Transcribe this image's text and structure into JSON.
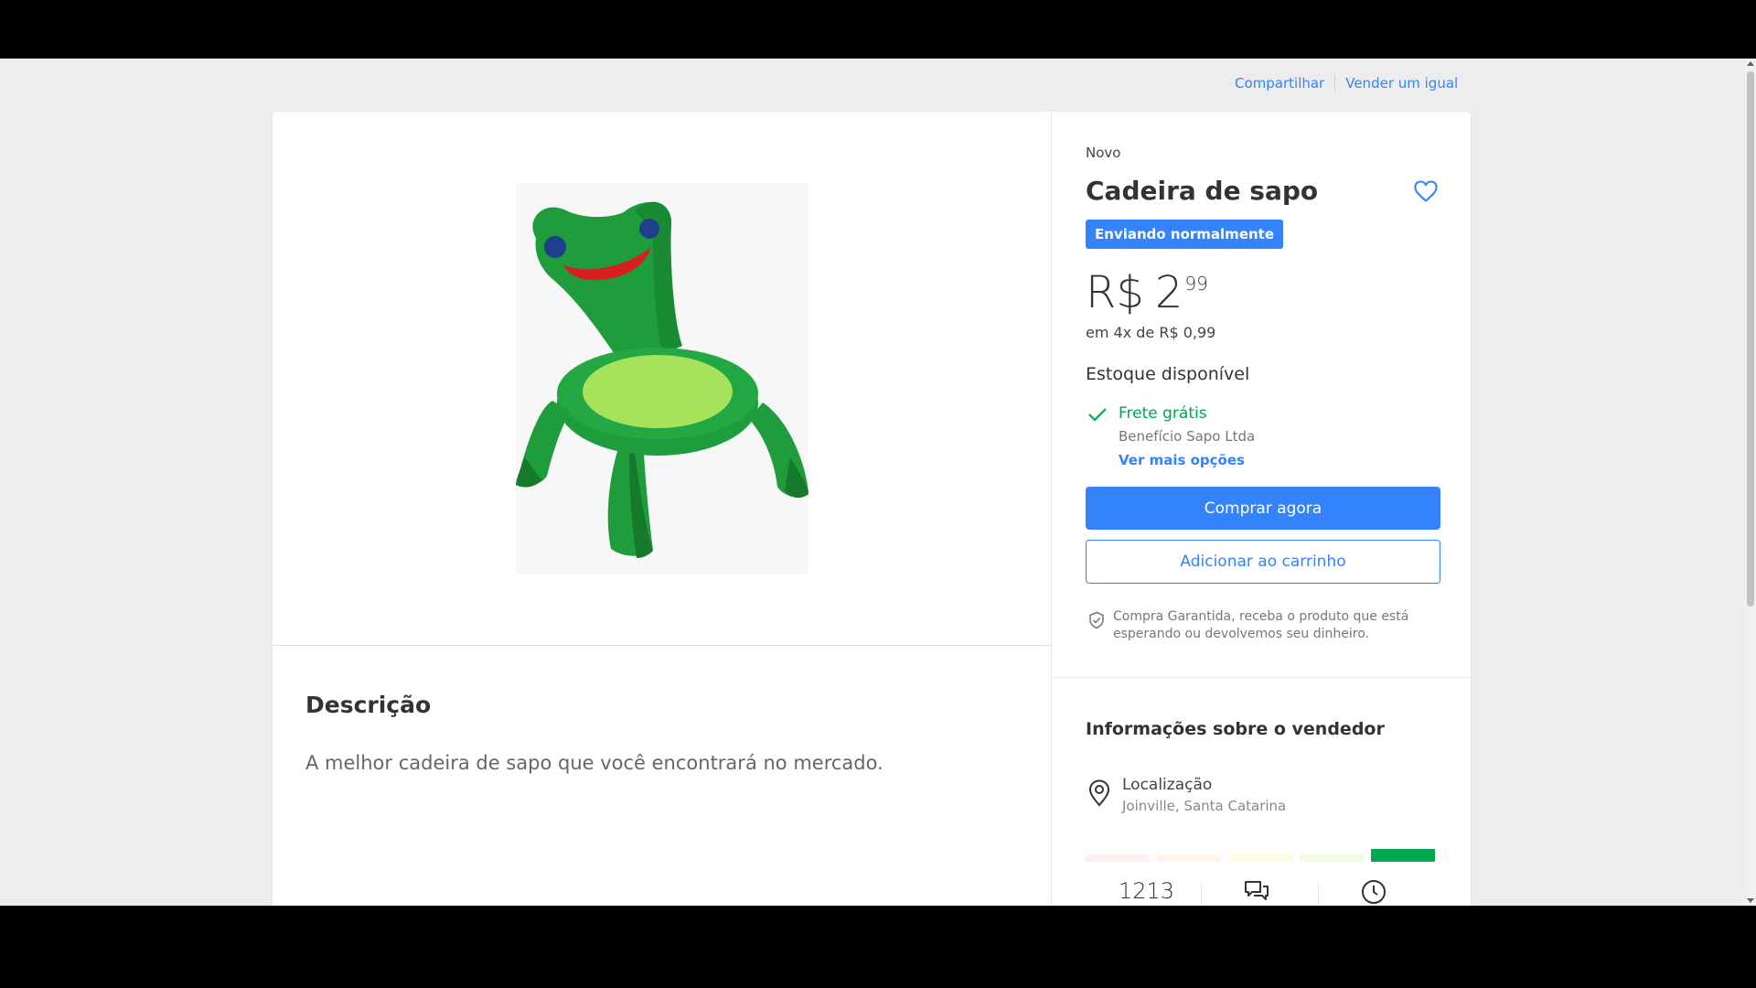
{
  "top_links": {
    "share": "Compartilhar",
    "sell_similar": "Vender um igual"
  },
  "product": {
    "condition": "Novo",
    "title": "Cadeira de sapo",
    "shipping_badge": "Enviando normalmente",
    "price": {
      "currency": "R$",
      "integer": "2",
      "cents": "99"
    },
    "installments": "em 4x de R$ 0,99",
    "stock": "Estoque disponível",
    "image_alt_icon": "frog-chair-image"
  },
  "shipping": {
    "title": "Frete grátis",
    "subtitle": "Benefício Sapo Ltda",
    "more_options": "Ver mais opções"
  },
  "actions": {
    "buy_now": "Comprar agora",
    "add_to_cart": "Adicionar ao carrinho"
  },
  "guarantee": {
    "text": "Compra Garantida, receba o produto que está esperando ou devolvemos seu dinheiro."
  },
  "description": {
    "title": "Descrição",
    "text": "A melhor cadeira de sapo que você encontrará no mercado."
  },
  "seller": {
    "title": "Informações sobre o vendedor",
    "location_label": "Localização",
    "location_value": "Joinville, Santa Catarina",
    "reputation_level": 5,
    "reputation_colors": [
      "#fff0f0",
      "#fff5e8",
      "#fffbe0",
      "#f1fde0",
      "#00a650"
    ],
    "sales_count": "1213"
  },
  "colors": {
    "accent": "#3483fa",
    "success": "#00a650"
  }
}
